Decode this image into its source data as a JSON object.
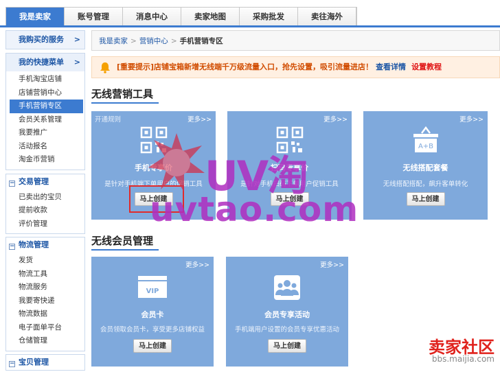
{
  "topnav": {
    "tabs": [
      {
        "label": "我是卖家",
        "active": true
      },
      {
        "label": "账号管理"
      },
      {
        "label": "消息中心"
      },
      {
        "label": "卖家地图"
      },
      {
        "label": "采购批发"
      },
      {
        "label": "卖往海外"
      }
    ]
  },
  "sidebar": {
    "bought_services": {
      "label": "我购买的服务",
      "arrow": ">"
    },
    "quick_menu": {
      "label": "我的快捷菜单",
      "arrow": ">",
      "items": [
        "手机淘宝店铺",
        "店铺营销中心",
        "手机营销专区",
        "会员关系管理",
        "我要推广",
        "活动报名",
        "淘金币营销"
      ],
      "selected_index": 2
    },
    "trade": {
      "label": "交易管理",
      "toggle": "−",
      "items": [
        "已卖出的宝贝",
        "提前收款",
        "评价管理"
      ]
    },
    "logistics": {
      "label": "物流管理",
      "toggle": "−",
      "items": [
        "发货",
        "物流工具",
        "物流服务",
        "我要寄快递",
        "物流数据",
        "电子面单平台",
        "仓储管理"
      ]
    },
    "goods": {
      "label": "宝贝管理",
      "toggle": "−"
    }
  },
  "breadcrumb": {
    "items": [
      "我是卖家",
      "营销中心"
    ],
    "current": "手机营销专区",
    "separator": ">"
  },
  "notice": {
    "text": "[重要提示]店铺宝箱新增无线端千万级流量入口，抢先设置，吸引流量进店！",
    "details_link": "查看详情",
    "tutorial_link": "设置教程"
  },
  "section1": {
    "title": "无线营销工具",
    "cards": [
      {
        "rule": "开通规则",
        "more": "更多>>",
        "title": "手机专享价",
        "desc": "是针对手机端下单用户的促销工具",
        "button": "马上创建",
        "icon": "qr-code-icon"
      },
      {
        "more": "更多>>",
        "title": "扫码专享价",
        "desc": "是针对手机扫码下单用户促销工具",
        "button": "马上创建",
        "icon": "qr-code-icon"
      },
      {
        "more": "更多>>",
        "title": "无线搭配套餐",
        "desc": "无线搭配搭配，飙升客单转化",
        "button": "马上创建",
        "icon": "gift-box-icon",
        "icon_text": "A+B"
      }
    ]
  },
  "section2": {
    "title": "无线会员管理",
    "cards": [
      {
        "more": "更多>>",
        "title": "会员卡",
        "desc": "会员领取会员卡，享受更多店铺权益",
        "button": "马上创建",
        "icon": "vip-card-icon",
        "icon_text": "VIP"
      },
      {
        "more": "更多>>",
        "title": "会员专享活动",
        "desc": "手机端用户设置的会员专享优惠活动",
        "button": "马上创建",
        "icon": "member-group-icon"
      }
    ]
  },
  "watermark": {
    "uv": "UV淘",
    "site": "uvtao.com",
    "brand": "卖家社区",
    "url": "bbs.maijia.com"
  },
  "colors": {
    "accent": "#3c7bd0",
    "card": "#7fa9dc",
    "notice": "#d14c00",
    "link": "#1d56a5",
    "highlight": "#e12a2a"
  }
}
